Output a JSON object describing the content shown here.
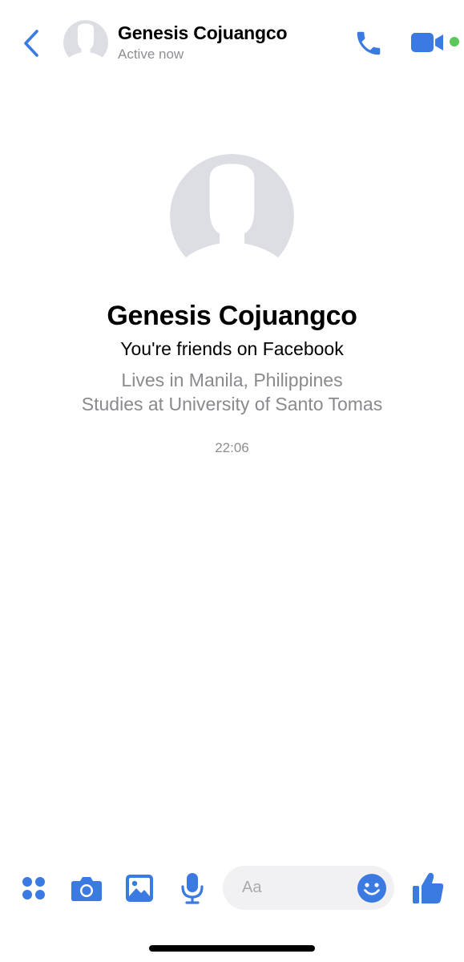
{
  "header": {
    "contact_name": "Genesis Cojuangco",
    "status": "Active now",
    "back_icon": "chevron-left-icon",
    "call_icon": "phone-icon",
    "video_icon": "video-camera-icon",
    "online": true
  },
  "profile": {
    "name": "Genesis Cojuangco",
    "friends_text": "You're friends on Facebook",
    "lives": "Lives in Manila, Philippines",
    "studies": "Studies at University of Santo Tomas"
  },
  "conversation": {
    "timestamp": "22:06"
  },
  "composer": {
    "placeholder": "Aa",
    "icons": [
      "grid-menu-icon",
      "camera-icon",
      "image-icon",
      "microphone-icon",
      "emoji-icon",
      "thumbs-up-icon"
    ]
  },
  "colors": {
    "accent": "#3b7ae0",
    "online_dot": "#5ac85a",
    "secondary_text": "#8a8a8e",
    "avatar_bg": "#dcdee3",
    "avatar_silhouette": "#ffffff",
    "composer_bg": "#f1f1f3"
  }
}
